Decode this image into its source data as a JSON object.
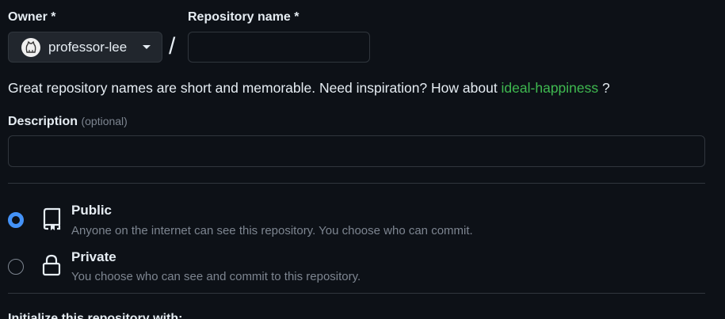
{
  "owner": {
    "label": "Owner *",
    "selected": "professor-lee"
  },
  "repository": {
    "label": "Repository name *",
    "value": "",
    "separator": "/"
  },
  "hint": {
    "text": "Great repository names are short and memorable. Need inspiration? How about ",
    "suggestion": "ideal-happiness",
    "suffix": " ?"
  },
  "description": {
    "label": "Description",
    "optional": "(optional)",
    "value": ""
  },
  "visibility": {
    "selected": "public",
    "options": [
      {
        "title": "Public",
        "description": "Anyone on the internet can see this repository. You choose who can commit.",
        "icon": "repo-icon"
      },
      {
        "title": "Private",
        "description": "You choose who can see and commit to this repository.",
        "icon": "lock-icon"
      }
    ]
  },
  "initialize": {
    "label": "Initialize this repository with:"
  },
  "colors": {
    "background": "#0d1117",
    "accent": "#4493f8",
    "suggestion": "#3fb950",
    "border": "#30363d",
    "muted": "#7d8590"
  }
}
